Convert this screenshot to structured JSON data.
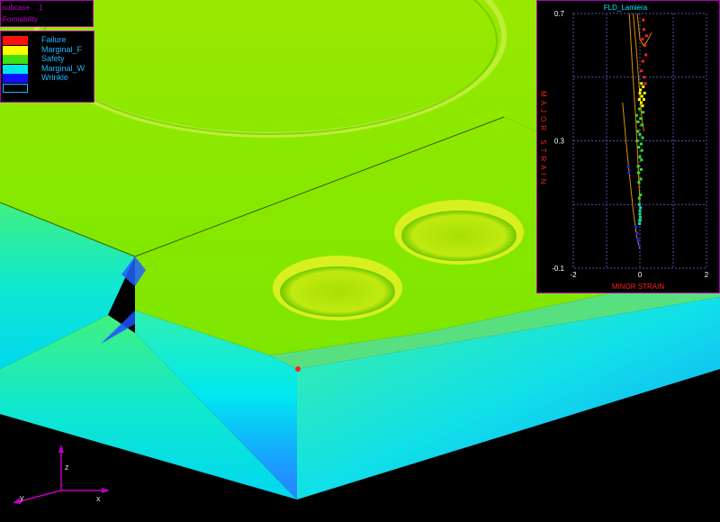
{
  "info_panel": {
    "label": "subcase",
    "value": "1",
    "mode": "Formability"
  },
  "legend": {
    "items": [
      {
        "label": "Failure",
        "color": "#ff1010"
      },
      {
        "label": "Marginal_F",
        "color": "#ffff00"
      },
      {
        "label": "Safety",
        "color": "#40e010"
      },
      {
        "label": "Marginal_W",
        "color": "#00e8e8"
      },
      {
        "label": "Wrinkle",
        "color": "#1010ff"
      },
      {
        "label": "",
        "color": "#000000"
      }
    ]
  },
  "axes_triad": {
    "x_label": "x",
    "y_label": "y",
    "z_label": "z"
  },
  "chart_data": {
    "type": "scatter",
    "title": "FLD_Lamiera",
    "xlabel": "MINOR STRAIN",
    "ylabel": "MAJOR STRAIN",
    "xlim": [
      -2,
      2
    ],
    "ylim": [
      -0.1,
      0.7
    ],
    "xticks": [
      "-2",
      "0",
      "2"
    ],
    "yticks": [
      "0.7",
      "0.3",
      "-0.1"
    ],
    "grid": true,
    "curves": [
      {
        "name": "",
        "x": [
          -0.32,
          -0.22,
          -0.12,
          -0.05,
          0.0
        ],
        "y": [
          0.7,
          0.52,
          0.36,
          0.22,
          0.1
        ]
      },
      {
        "name": "",
        "x": [
          -0.2,
          -0.1,
          0.0,
          0.05,
          0.12
        ],
        "y": [
          0.7,
          0.58,
          0.44,
          0.38,
          0.33
        ]
      },
      {
        "name": "",
        "x": [
          -0.52,
          -0.42,
          -0.3,
          -0.2,
          -0.1,
          0.0
        ],
        "y": [
          0.42,
          0.3,
          0.18,
          0.08,
          0.0,
          -0.04
        ]
      },
      {
        "name": "",
        "x": [
          -0.08,
          0.0,
          0.1,
          0.2,
          0.35
        ],
        "y": [
          0.7,
          0.62,
          0.6,
          0.61,
          0.64
        ]
      }
    ],
    "series": [
      {
        "name": "Failure",
        "color": "#ff2020",
        "x": [
          0.1,
          0.12,
          0.15,
          0.09,
          0.18,
          0.05,
          0.13,
          0.2,
          0.08,
          0.16
        ],
        "y": [
          0.68,
          0.65,
          0.6,
          0.55,
          0.57,
          0.52,
          0.5,
          0.63,
          0.62,
          0.48
        ]
      },
      {
        "name": "Marginal_F",
        "color": "#ffff00",
        "x": [
          0.02,
          0.06,
          0.1,
          0.04,
          0.12,
          0.0,
          0.08,
          0.14,
          -0.02,
          0.05
        ],
        "y": [
          0.46,
          0.44,
          0.47,
          0.42,
          0.43,
          0.45,
          0.41,
          0.45,
          0.43,
          0.48
        ]
      },
      {
        "name": "Safety",
        "color": "#30e030",
        "x": [
          -0.1,
          -0.06,
          -0.02,
          0.02,
          0.06,
          0.1,
          -0.08,
          -0.04,
          0.0,
          0.04,
          0.08,
          -0.05,
          0.0,
          0.05,
          -0.03,
          0.03,
          -0.02,
          0.02,
          0.0,
          -0.01,
          0.01,
          -0.06,
          0.06,
          -0.04,
          0.04
        ],
        "y": [
          0.38,
          0.36,
          0.4,
          0.37,
          0.35,
          0.39,
          0.3,
          0.28,
          0.32,
          0.29,
          0.31,
          0.22,
          0.25,
          0.24,
          0.17,
          0.18,
          0.12,
          0.13,
          0.08,
          0.05,
          0.06,
          0.33,
          0.27,
          0.2,
          0.21
        ]
      },
      {
        "name": "Marginal_W",
        "color": "#00e0e0",
        "x": [
          -0.02,
          0.0,
          0.02,
          -0.01,
          0.01
        ],
        "y": [
          0.1,
          0.07,
          0.09,
          0.04,
          0.05
        ]
      },
      {
        "name": "Wrinkle",
        "color": "#2020ff",
        "x": [
          -0.35,
          -0.33,
          -0.12,
          -0.08,
          -0.05,
          -0.02
        ],
        "y": [
          0.22,
          0.2,
          0.03,
          0.01,
          -0.01,
          -0.03
        ]
      }
    ]
  }
}
